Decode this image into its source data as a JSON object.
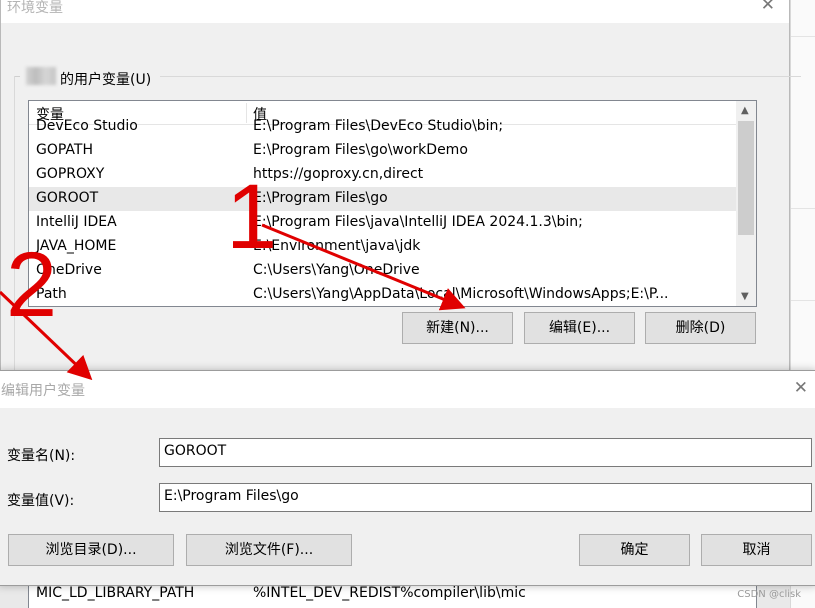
{
  "main_window": {
    "title": "环境变量",
    "close_glyph": "✕",
    "group_label": "的用户变量(U)",
    "columns": {
      "name": "变量",
      "value": "值"
    },
    "rows": [
      {
        "name": "DevEco Studio",
        "value": "E:\\Program Files\\DevEco Studio\\bin;"
      },
      {
        "name": "GOPATH",
        "value": "E:\\Program Files\\go\\workDemo"
      },
      {
        "name": "GOPROXY",
        "value": "https://goproxy.cn,direct"
      },
      {
        "name": "GOROOT",
        "value": "E:\\Program Files\\go"
      },
      {
        "name": "IntelliJ IDEA",
        "value": "E:\\Program Files\\java\\IntelliJ IDEA 2024.1.3\\bin;"
      },
      {
        "name": "JAVA_HOME",
        "value": "E:\\Environment\\java\\jdk"
      },
      {
        "name": "OneDrive",
        "value": "C:\\Users\\Yang\\OneDrive"
      },
      {
        "name": "Path",
        "value": "C:\\Users\\Yang\\AppData\\Local\\Microsoft\\WindowsApps;E:\\P..."
      }
    ],
    "selected_row": "GOROOT",
    "buttons": {
      "new": "新建(N)...",
      "edit": "编辑(E)...",
      "delete": "删除(D)"
    },
    "peek_row": {
      "name": "MIC_LD_LIBRARY_PATH",
      "value": "%INTEL_DEV_REDIST%compiler\\lib\\mic"
    }
  },
  "edit_dialog": {
    "title": "编辑用户变量",
    "close_glyph": "✕",
    "name_label": "变量名(N):",
    "name_value": "GOROOT",
    "value_label": "变量值(V):",
    "value_value": "E:\\Program Files\\go",
    "buttons": {
      "browse_dir": "浏览目录(D)...",
      "browse_file": "浏览文件(F)...",
      "ok": "确定",
      "cancel": "取消"
    }
  },
  "annotations": {
    "label_1": "1",
    "label_2": "2",
    "arrow_color": "#e00000"
  },
  "watermark": "CSDN @clisk"
}
